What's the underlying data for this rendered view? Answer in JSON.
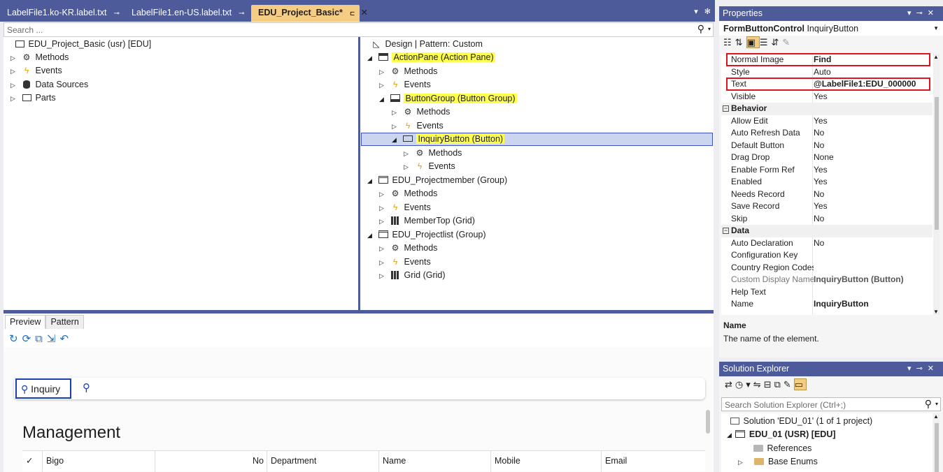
{
  "tabs": [
    {
      "label": "LabelFile1.ko-KR.label.txt",
      "active": false
    },
    {
      "label": "LabelFile1.en-US.label.txt",
      "active": false
    },
    {
      "label": "EDU_Project_Basic*",
      "active": true
    }
  ],
  "icons": {
    "pin": "pin-icon",
    "close": "close-icon",
    "search": "search-icon",
    "gear": "gear-icon",
    "dropdown": "chevron-down-icon"
  },
  "search": {
    "placeholder": "Search ..."
  },
  "left_tree": {
    "root": "EDU_Project_Basic (usr) [EDU]",
    "items": [
      "Methods",
      "Events",
      "Data Sources",
      "Parts"
    ]
  },
  "designer": {
    "header": "Design | Pattern: Custom",
    "action_pane": "ActionPane (Action Pane)",
    "methods": "Methods",
    "events": "Events",
    "button_group": "ButtonGroup (Button Group)",
    "inquiry_button": "InquiryButton (Button)",
    "projectmember": "EDU_Projectmember (Group)",
    "membertop": "MemberTop (Grid)",
    "projectlist": "EDU_Projectlist (Group)",
    "grid": "Grid (Grid)"
  },
  "preview": {
    "tab_preview": "Preview",
    "tab_pattern": "Pattern",
    "inquiry_label": "Inquiry",
    "title": "Management",
    "columns": [
      "Bigo",
      "No",
      "Department",
      "Name",
      "Mobile",
      "Email"
    ]
  },
  "properties": {
    "title": "Properties",
    "object_type": "FormButtonControl",
    "object_name": "InquiryButton",
    "rows": [
      {
        "k": "Normal Image",
        "v": "Find"
      },
      {
        "k": "Style",
        "v": "Auto"
      },
      {
        "k": "Text",
        "v": "@LabelFile1:EDU_000000"
      },
      {
        "k": "Visible",
        "v": "Yes"
      },
      {
        "k": "Behavior",
        "v": ""
      },
      {
        "k": "Allow Edit",
        "v": "Yes"
      },
      {
        "k": "Auto Refresh Data",
        "v": "No"
      },
      {
        "k": "Default Button",
        "v": "No"
      },
      {
        "k": "Drag Drop",
        "v": "None"
      },
      {
        "k": "Enable Form Ref",
        "v": "Yes"
      },
      {
        "k": "Enabled",
        "v": "Yes"
      },
      {
        "k": "Needs Record",
        "v": "No"
      },
      {
        "k": "Save Record",
        "v": "Yes"
      },
      {
        "k": "Skip",
        "v": "No"
      },
      {
        "k": "Data",
        "v": ""
      },
      {
        "k": "Auto Declaration",
        "v": "No"
      },
      {
        "k": "Configuration Key",
        "v": ""
      },
      {
        "k": "Country Region Codes",
        "v": ""
      },
      {
        "k": "Custom Display Name",
        "v": "InquiryButton (Button)"
      },
      {
        "k": "Help Text",
        "v": ""
      },
      {
        "k": "Name",
        "v": "InquiryButton"
      }
    ],
    "desc_title": "Name",
    "desc_text": "The name of the element."
  },
  "solution_explorer": {
    "title": "Solution Explorer",
    "search_placeholder": "Search Solution Explorer (Ctrl+;)",
    "solution": "Solution 'EDU_01' (1 of 1 project)",
    "project": "EDU_01 (USR) [EDU]",
    "references": "References",
    "base_enums": "Base Enums"
  },
  "colors": {
    "accent": "#4d5b9a",
    "active_tab": "#f5cc84",
    "highlight": "#ffff4d",
    "selection": "#ccd5f0",
    "red_box": "#d9161f"
  }
}
